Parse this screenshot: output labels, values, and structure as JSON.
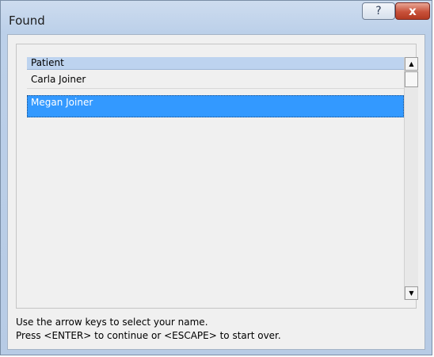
{
  "window": {
    "title": "Found",
    "help_glyph": "?",
    "close_glyph": "x"
  },
  "list": {
    "header": "Patient",
    "rows": [
      "Carla Joiner",
      "Megan Joiner"
    ],
    "selected_index": 1
  },
  "scrollbar": {
    "up_glyph": "▲",
    "down_glyph": "▼"
  },
  "instructions": {
    "line1": "Use the arrow keys to select your name.",
    "line2": "Press <ENTER> to continue or <ESCAPE> to start over."
  },
  "colors": {
    "selection": "#3399ff",
    "header": "#bdd3ef",
    "close_button": "#c8513a"
  }
}
